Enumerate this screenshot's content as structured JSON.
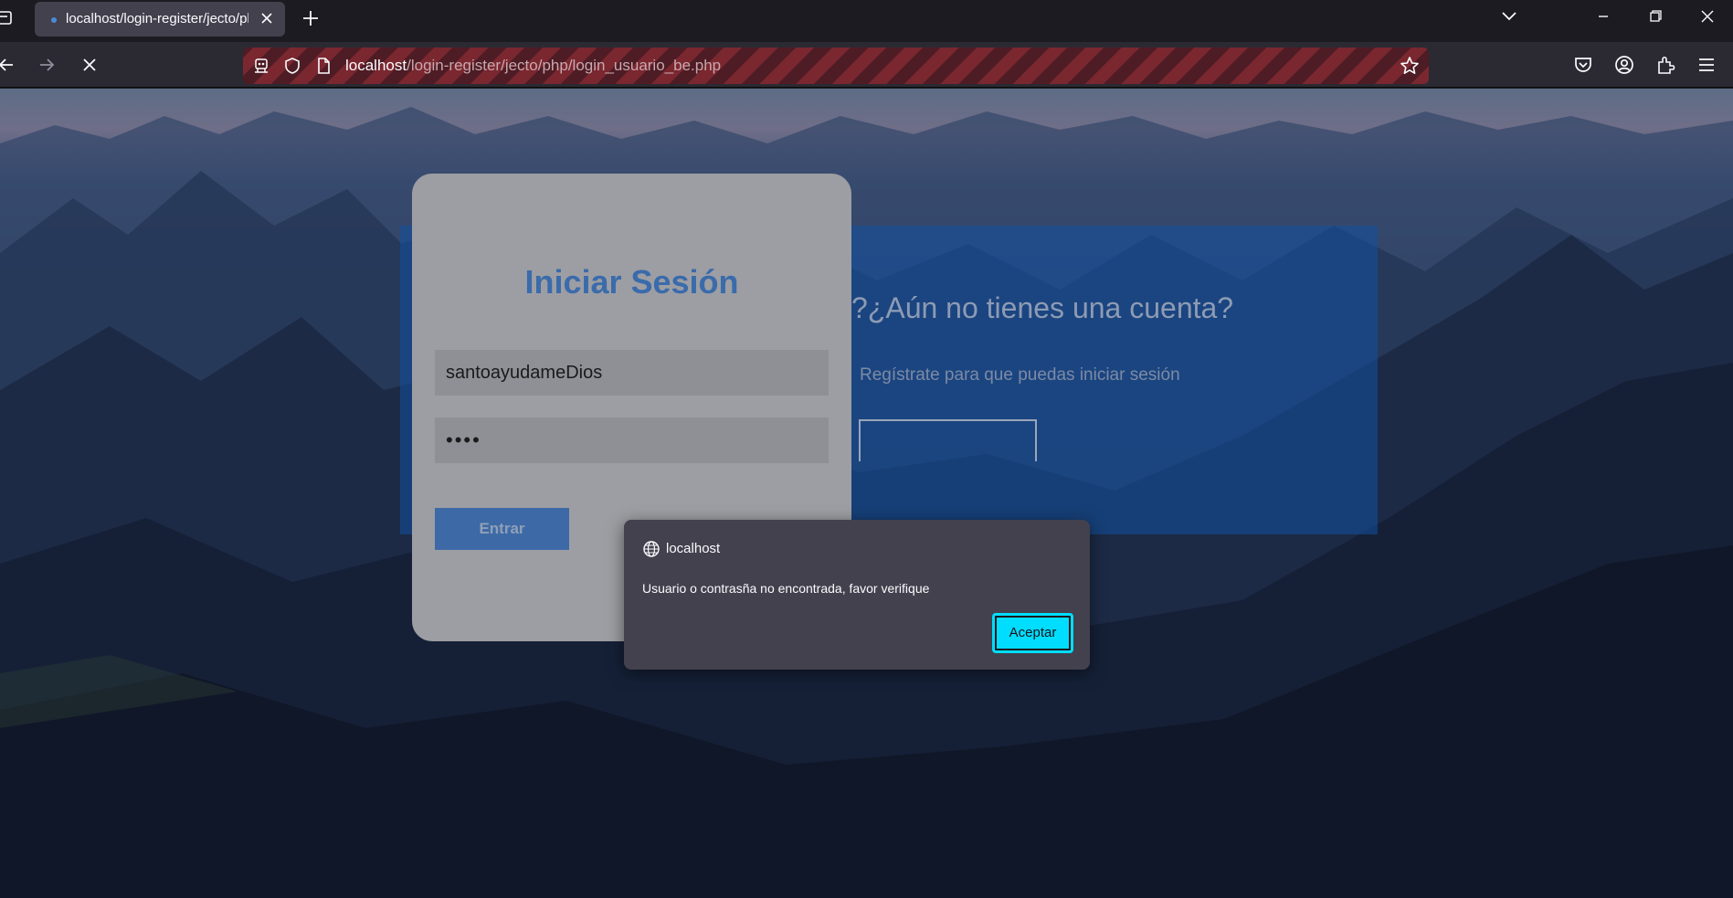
{
  "browser": {
    "tab_title": "localhost/login-register/jecto/php/login_usuario_be.php",
    "url_host": "localhost",
    "url_path": "/login-register/jecto/php/login_usuario_be.php"
  },
  "login": {
    "title": "Iniciar Sesión",
    "username_value": "santoayudameDios",
    "password_value": "••••",
    "submit_label": "Entrar"
  },
  "register_panel": {
    "title": "?¿Aún no tienes una cuenta?",
    "subtitle": "Regístrate para que puedas iniciar sesión"
  },
  "dialog": {
    "origin": "localhost",
    "message": "Usuario o contrasña no encontrada, favor verifique",
    "accept_label": "Aceptar"
  },
  "colors": {
    "dialog_accent": "#00ddff",
    "title_blue": "#3a6bab"
  }
}
